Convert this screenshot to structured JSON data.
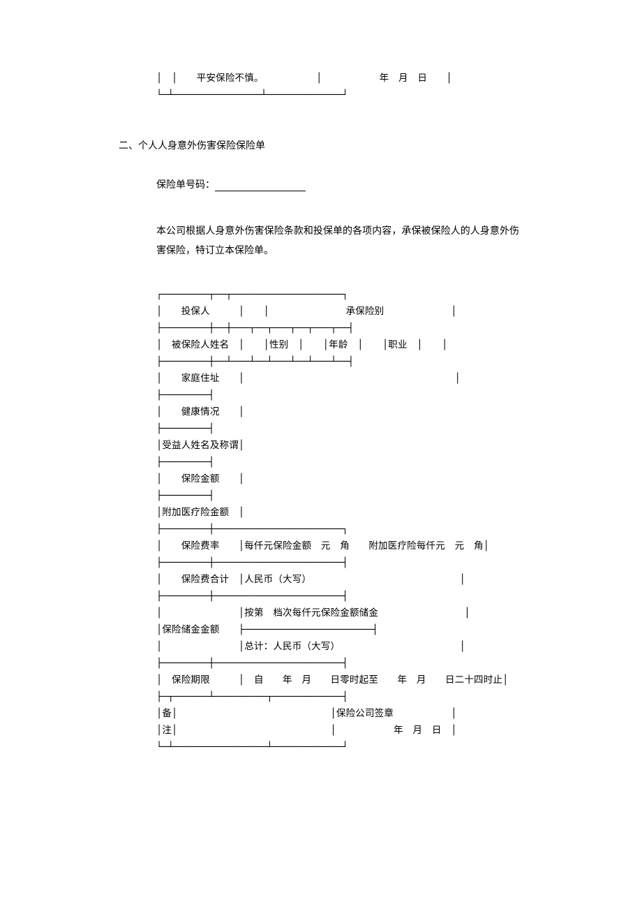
{
  "top_fragment": {
    "text": "平安保险不慎。",
    "date": "年　月　日"
  },
  "section_title": "二、个人人身意外伤害保险保险单",
  "policy_no_label": "保险单号码：",
  "intro": "本公司根据人身意外伤害保险条款和投保单的各项内容，承保被保险人的人身意外伤害保险，特订立本保险单。",
  "labels": {
    "applicant": "投保人",
    "coverage_type": "承保险别",
    "insured_name": "被保险人姓名",
    "gender": "性别",
    "age": "年龄",
    "occupation": "职业",
    "address": "家庭住址",
    "health": "健康情况",
    "beneficiary": "受益人姓名及称谓",
    "sum_insured": "保险金额",
    "additional_medical": "附加医疗险金额",
    "premium_rate": "保险费率",
    "premium_rate_text": "每仟元保险金额　元　角　　附加医疗险每仟元　元　角",
    "premium_total": "保险费合计",
    "rmb_upper": "人民币（大写）",
    "savings_amount": "保险储金金额",
    "savings_line1": "按第　档次每仟元保险金额储金",
    "savings_line2": "总计：人民币（大写）",
    "period": "保险期限",
    "period_text": "自　　年　月　　日零时起至　　年　月　　日二十四时止",
    "remarks": "备",
    "remarks2": "注",
    "company_sign": "保险公司签章",
    "sign_date": "年　月　日"
  }
}
